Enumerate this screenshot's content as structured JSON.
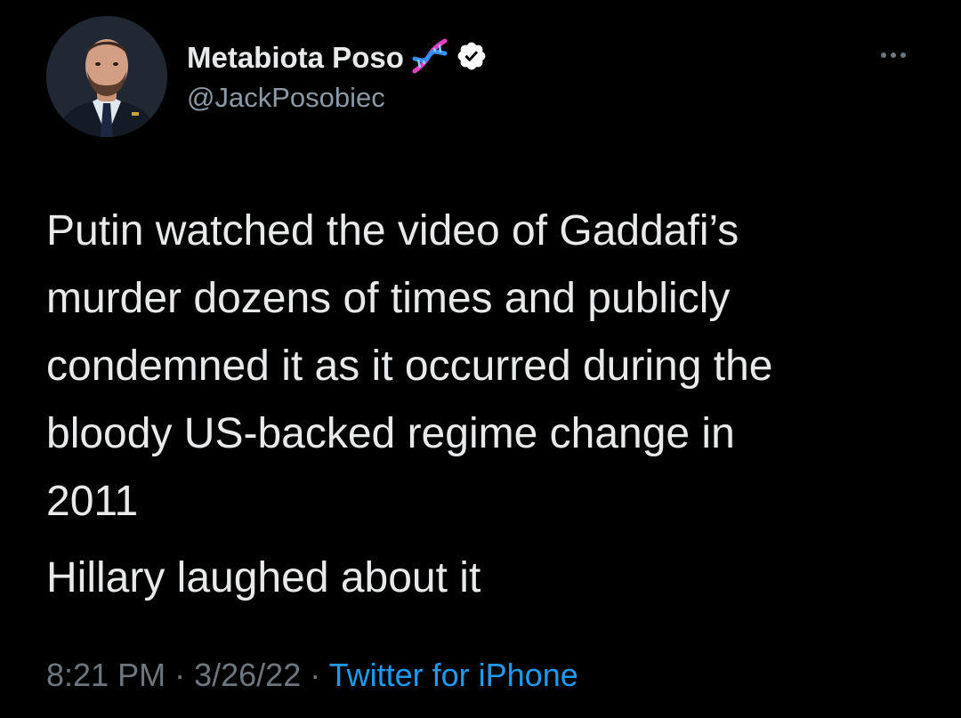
{
  "tweet": {
    "author": {
      "display_name": "Metabiota Poso",
      "handle": "@JackPosobiec",
      "verified": true,
      "name_emoji_icon": "dna-icon",
      "avatar_icon": "profile-photo"
    },
    "more_icon": "more-horizontal-icon",
    "body_lines": [
      "Putin watched the video of Gaddafi’s",
      "murder dozens of times and publicly",
      "condemned it as it occurred during the",
      "bloody US-backed regime change in",
      "2011"
    ],
    "second_paragraph": "Hillary laughed about it",
    "time": "8:21 PM",
    "separator": "·",
    "date": "3/26/22",
    "source": "Twitter for iPhone"
  },
  "colors": {
    "background": "#000000",
    "text_primary": "#e7e9ea",
    "text_secondary": "#6e767d",
    "link": "#1d9bf0",
    "verified_badge": "#ffffff"
  }
}
